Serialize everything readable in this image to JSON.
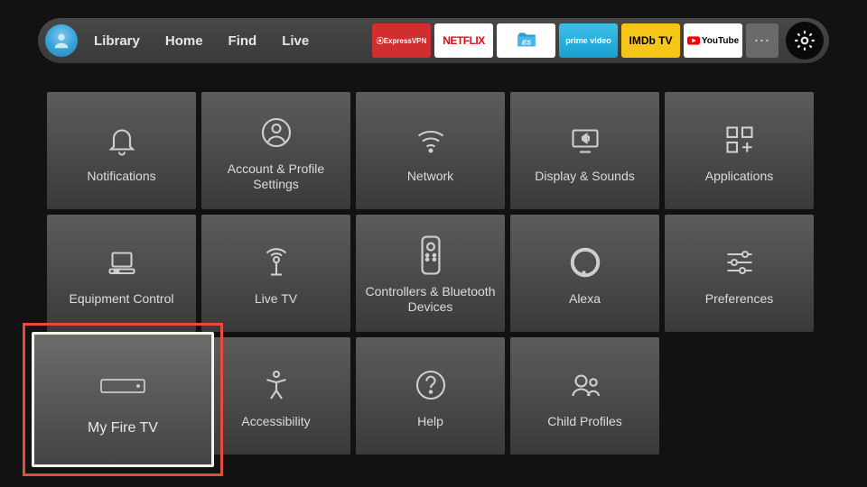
{
  "nav": {
    "items": [
      "Library",
      "Home",
      "Find",
      "Live"
    ]
  },
  "apps": {
    "express": "ExpressVPN",
    "netflix": "NETFLIX",
    "prime": "prime video",
    "imdb": "IMDb TV",
    "youtube": "YouTube"
  },
  "tiles": {
    "notifications": "Notifications",
    "account": "Account & Profile Settings",
    "network": "Network",
    "display": "Display & Sounds",
    "applications": "Applications",
    "equipment": "Equipment Control",
    "livetv": "Live TV",
    "controllers": "Controllers & Bluetooth Devices",
    "alexa": "Alexa",
    "preferences": "Preferences",
    "myfiretv": "My Fire TV",
    "accessibility": "Accessibility",
    "help": "Help",
    "childprofiles": "Child Profiles"
  }
}
